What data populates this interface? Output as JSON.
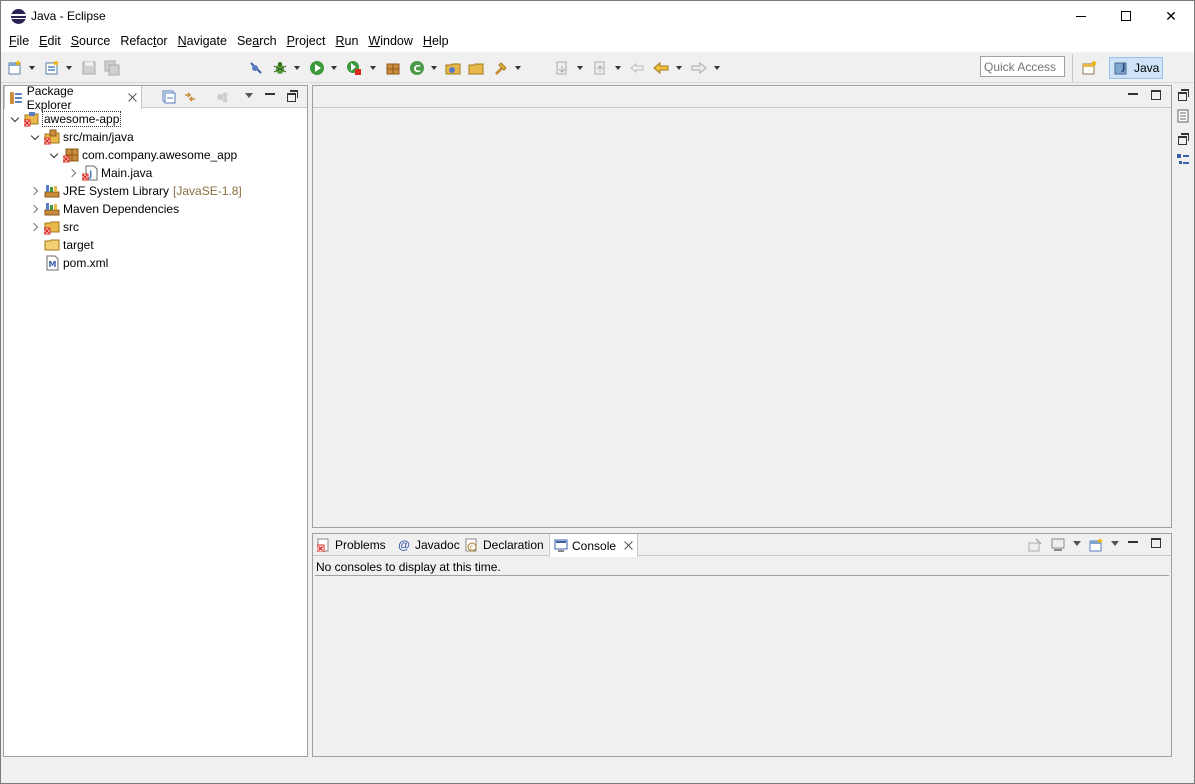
{
  "window": {
    "title": "Java - Eclipse",
    "minimize_symbol": "",
    "close_symbol": "✕"
  },
  "menu": [
    {
      "pre": "",
      "u": "F",
      "post": "ile"
    },
    {
      "pre": "",
      "u": "E",
      "post": "dit"
    },
    {
      "pre": "",
      "u": "S",
      "post": "ource"
    },
    {
      "pre": "Refac",
      "u": "t",
      "post": "or"
    },
    {
      "pre": "",
      "u": "N",
      "post": "avigate"
    },
    {
      "pre": "Se",
      "u": "a",
      "post": "rch"
    },
    {
      "pre": "",
      "u": "P",
      "post": "roject"
    },
    {
      "pre": "",
      "u": "R",
      "post": "un"
    },
    {
      "pre": "",
      "u": "W",
      "post": "indow"
    },
    {
      "pre": "",
      "u": "H",
      "post": "elp"
    }
  ],
  "toolbar": {
    "quick_access_placeholder": "Quick Access",
    "perspective_label": "Java"
  },
  "package_explorer": {
    "tab_label": "Package Explorer",
    "tree": [
      {
        "label": "awesome-app",
        "decoration": "",
        "icon": "project-icon",
        "twisty": "expanded"
      },
      {
        "label": "src/main/java",
        "decoration": "",
        "icon": "source-folder-icon",
        "twisty": "expanded"
      },
      {
        "label": "com.company.awesome_app",
        "decoration": "",
        "icon": "package-icon",
        "twisty": "expanded"
      },
      {
        "label": "Main.java",
        "decoration": "",
        "icon": "java-file-icon",
        "twisty": "collapsed"
      },
      {
        "label": "JRE System Library",
        "decoration": "[JavaSE-1.8]",
        "icon": "library-icon",
        "twisty": "collapsed"
      },
      {
        "label": "Maven Dependencies",
        "decoration": "",
        "icon": "library-icon",
        "twisty": "collapsed"
      },
      {
        "label": "src",
        "decoration": "",
        "icon": "folder-error-icon",
        "twisty": "collapsed"
      },
      {
        "label": "target",
        "decoration": "",
        "icon": "folder-icon",
        "twisty": "none"
      },
      {
        "label": "pom.xml",
        "decoration": "",
        "icon": "maven-file-icon",
        "twisty": "none"
      }
    ]
  },
  "bottom_tabs": [
    {
      "label": "Problems",
      "icon": "problems-icon"
    },
    {
      "label": "Javadoc",
      "icon": "javadoc-icon"
    },
    {
      "label": "Declaration",
      "icon": "declaration-icon"
    },
    {
      "label": "Console",
      "icon": "console-icon"
    }
  ],
  "console": {
    "message": "No consoles to display at this time."
  },
  "colors": {
    "accent": "#cfe3f7",
    "error_red": "#d9281d",
    "folder_yellow": "#e8b94a",
    "package_brown": "#b5651d"
  }
}
